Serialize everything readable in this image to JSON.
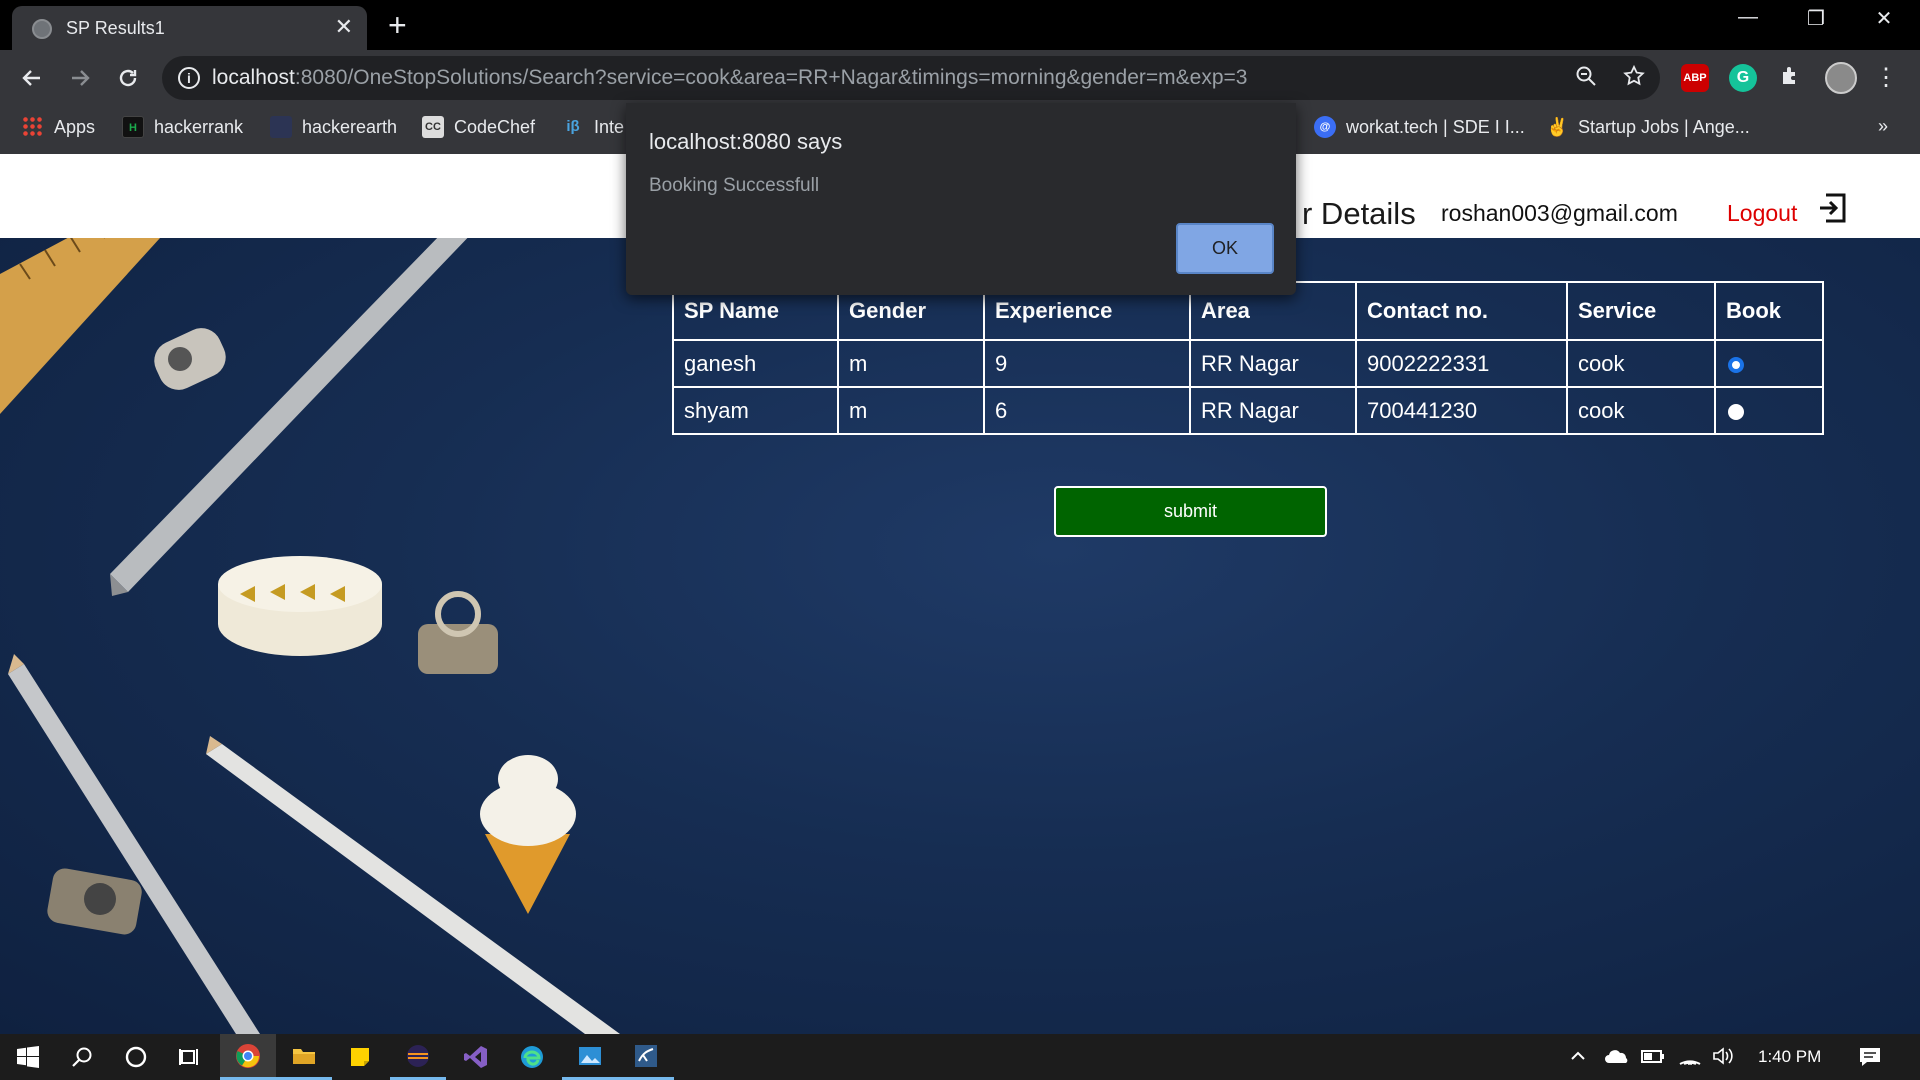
{
  "browser": {
    "tab_title": "SP Results1",
    "tab_close": "✕",
    "new_tab": "+",
    "url_host": "localhost",
    "url_rest": ":8080/OneStopSolutions/Search?service=cook&area=RR+Nagar&timings=morning&gender=m&exp=3",
    "extensions": {
      "abp": "ABP",
      "grammarly": "G"
    },
    "window_controls": {
      "minimize": "—",
      "restore": "❐",
      "close": "✕"
    }
  },
  "bookmarks": [
    {
      "label": "Apps"
    },
    {
      "label": "hackerrank",
      "icon_text": "H"
    },
    {
      "label": "hackerearth"
    },
    {
      "label": "CodeChef",
      "icon_text": "CC"
    },
    {
      "label": "Inte",
      "icon_text": "iβ"
    },
    {
      "label": "workat.tech | SDE I I...",
      "icon_text": "@"
    },
    {
      "label": "Startup Jobs | Ange..."
    }
  ],
  "bookmarks_more": "»",
  "header": {
    "title": "r Details",
    "email": "roshan003@gmail.com",
    "logout": "Logout"
  },
  "table": {
    "columns": [
      "SP Name",
      "Gender",
      "Experience",
      "Area",
      "Contact no.",
      "Service",
      "Book"
    ],
    "rows": [
      {
        "name": "ganesh",
        "gender": "m",
        "experience": "9",
        "area": "RR Nagar",
        "contact": "9002222331",
        "service": "cook",
        "booked": true
      },
      {
        "name": "shyam",
        "gender": "m",
        "experience": "6",
        "area": "RR Nagar",
        "contact": "700441230",
        "service": "cook",
        "booked": false
      }
    ]
  },
  "submit_label": "submit",
  "dialog": {
    "title": "localhost:8080 says",
    "message": "Booking Successfull",
    "ok_label": "OK"
  },
  "taskbar": {
    "clock": "1:40 PM"
  },
  "colors": {
    "submit_bg": "#006400",
    "logout": "#dd0000",
    "dialog_ok": "#8ab4f8",
    "page_bg": "#162d52"
  }
}
